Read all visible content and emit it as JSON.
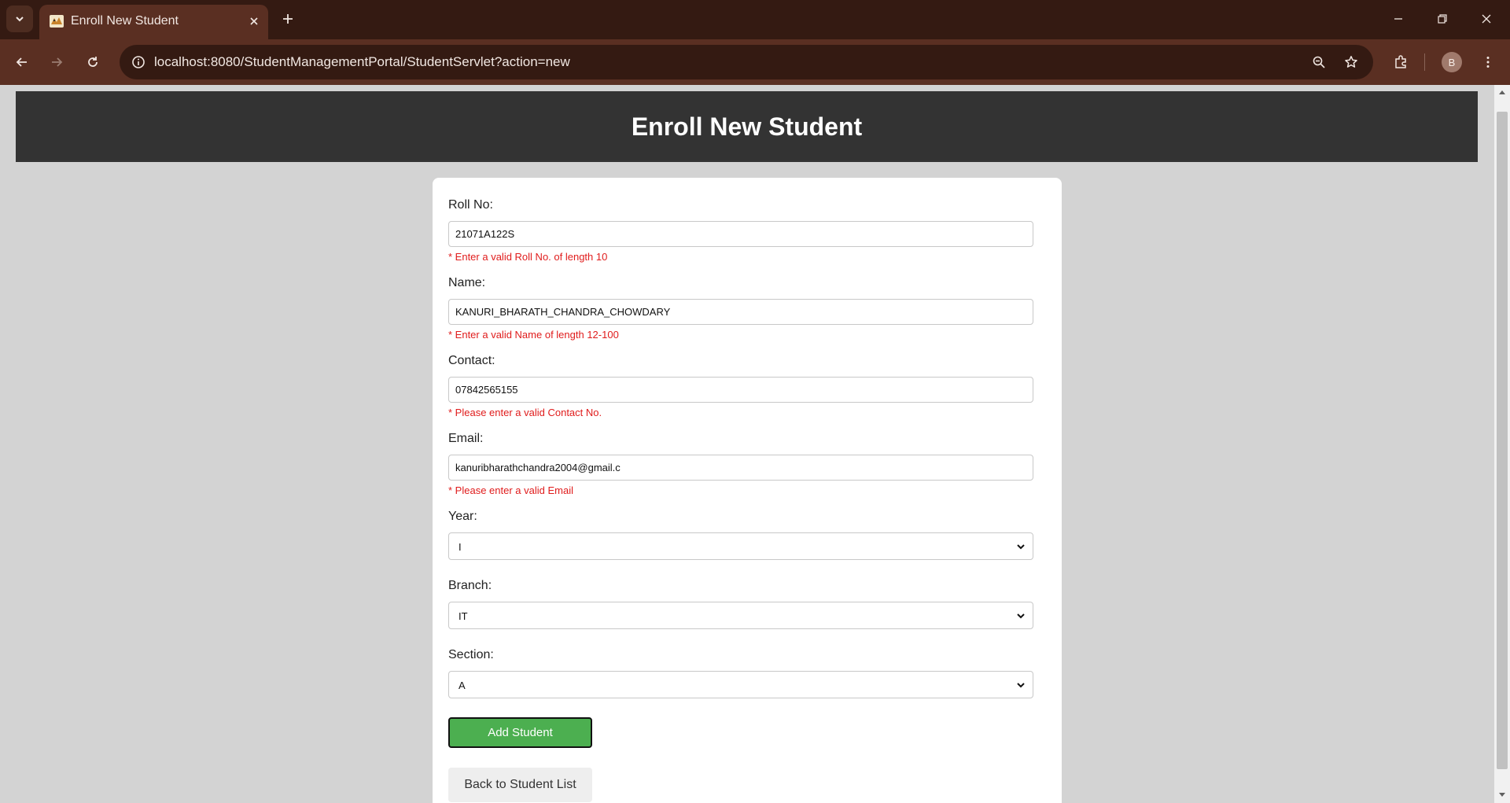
{
  "browser": {
    "tab_title": "Enroll New Student",
    "url": "localhost:8080/StudentManagementPortal/StudentServlet?action=new",
    "profile_initial": "B"
  },
  "page": {
    "title": "Enroll New Student"
  },
  "form": {
    "roll_no": {
      "label": "Roll No:",
      "value": "21071A122S",
      "error": "* Enter a valid Roll No. of length 10"
    },
    "name": {
      "label": "Name:",
      "value": "KANURI_BHARATH_CHANDRA_CHOWDARY",
      "error": "* Enter a valid Name of length 12-100"
    },
    "contact": {
      "label": "Contact:",
      "value": "07842565155",
      "error": "* Please enter a valid Contact No."
    },
    "email": {
      "label": "Email:",
      "value": "kanuribharathchandra2004@gmail.c",
      "error": "* Please enter a valid Email"
    },
    "year": {
      "label": "Year:",
      "selected": "I"
    },
    "branch": {
      "label": "Branch:",
      "selected": "IT"
    },
    "section": {
      "label": "Section:",
      "selected": "A"
    },
    "add_button": "Add Student",
    "back_button": "Back to Student List"
  },
  "colors": {
    "chrome_dark": "#341a12",
    "chrome_toolbar": "#5a2f22",
    "header_bg": "#333333",
    "error": "#e01c1c",
    "add_button": "#4caf50"
  }
}
